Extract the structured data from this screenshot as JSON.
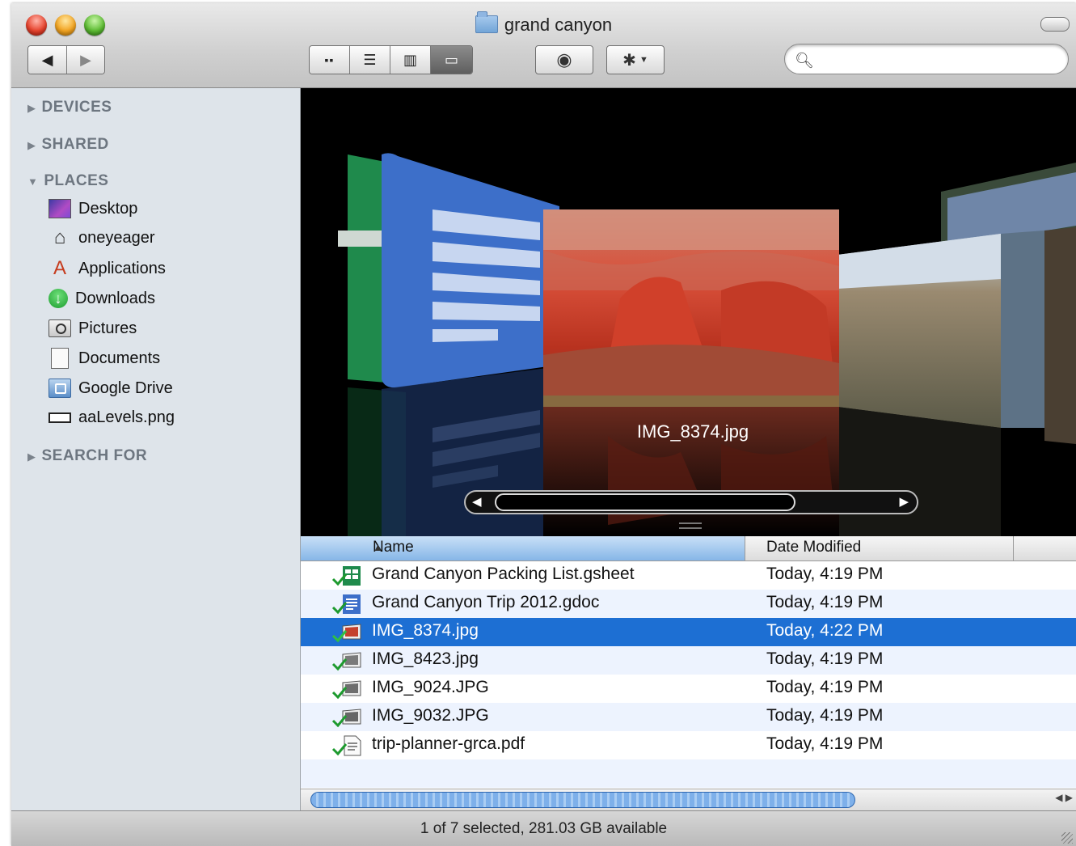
{
  "window": {
    "title": "grand canyon"
  },
  "toolbar": {
    "back_icon": "left-arrow-icon",
    "forward_icon": "right-arrow-icon",
    "view_modes": [
      "icon-view",
      "list-view",
      "column-view",
      "cover-flow-view"
    ],
    "active_view": "cover-flow-view",
    "quicklook_icon": "eye-icon",
    "action_icon": "gear-icon",
    "search_placeholder": "",
    "search_value": ""
  },
  "sidebar": {
    "sections": {
      "devices": "DEVICES",
      "shared": "SHARED",
      "places": "PLACES",
      "search_for": "SEARCH FOR"
    },
    "places": [
      {
        "label": "Desktop",
        "icon": "desktop-icon"
      },
      {
        "label": "oneyeager",
        "icon": "home-icon"
      },
      {
        "label": "Applications",
        "icon": "applications-icon"
      },
      {
        "label": "Downloads",
        "icon": "downloads-icon"
      },
      {
        "label": "Pictures",
        "icon": "pictures-icon"
      },
      {
        "label": "Documents",
        "icon": "documents-icon"
      },
      {
        "label": "Google Drive",
        "icon": "google-drive-icon"
      },
      {
        "label": "aaLevels.png",
        "icon": "image-file-icon"
      }
    ]
  },
  "coverflow": {
    "current_label": "IMG_8374.jpg"
  },
  "list": {
    "headers": {
      "name": "Name",
      "date": "Date Modified"
    },
    "rows": [
      {
        "name": "Grand Canyon Packing List.gsheet",
        "date": "Today, 4:19 PM",
        "icon": "gsheet-icon"
      },
      {
        "name": "Grand Canyon Trip 2012.gdoc",
        "date": "Today, 4:19 PM",
        "icon": "gdoc-icon"
      },
      {
        "name": "IMG_8374.jpg",
        "date": "Today, 4:22 PM",
        "icon": "image-icon"
      },
      {
        "name": "IMG_8423.jpg",
        "date": "Today, 4:19 PM",
        "icon": "image-icon"
      },
      {
        "name": "IMG_9024.JPG",
        "date": "Today, 4:19 PM",
        "icon": "image-icon"
      },
      {
        "name": "IMG_9032.JPG",
        "date": "Today, 4:19 PM",
        "icon": "image-icon"
      },
      {
        "name": "trip-planner-grca.pdf",
        "date": "Today, 4:19 PM",
        "icon": "pdf-icon"
      }
    ],
    "selected_row": 2
  },
  "status": {
    "text": "1 of 7 selected, 281.03 GB available"
  },
  "colors": {
    "selection": "#1d6fd3",
    "sidebar_bg": "#dee4ea",
    "sync_check": "#1d9a2e"
  }
}
